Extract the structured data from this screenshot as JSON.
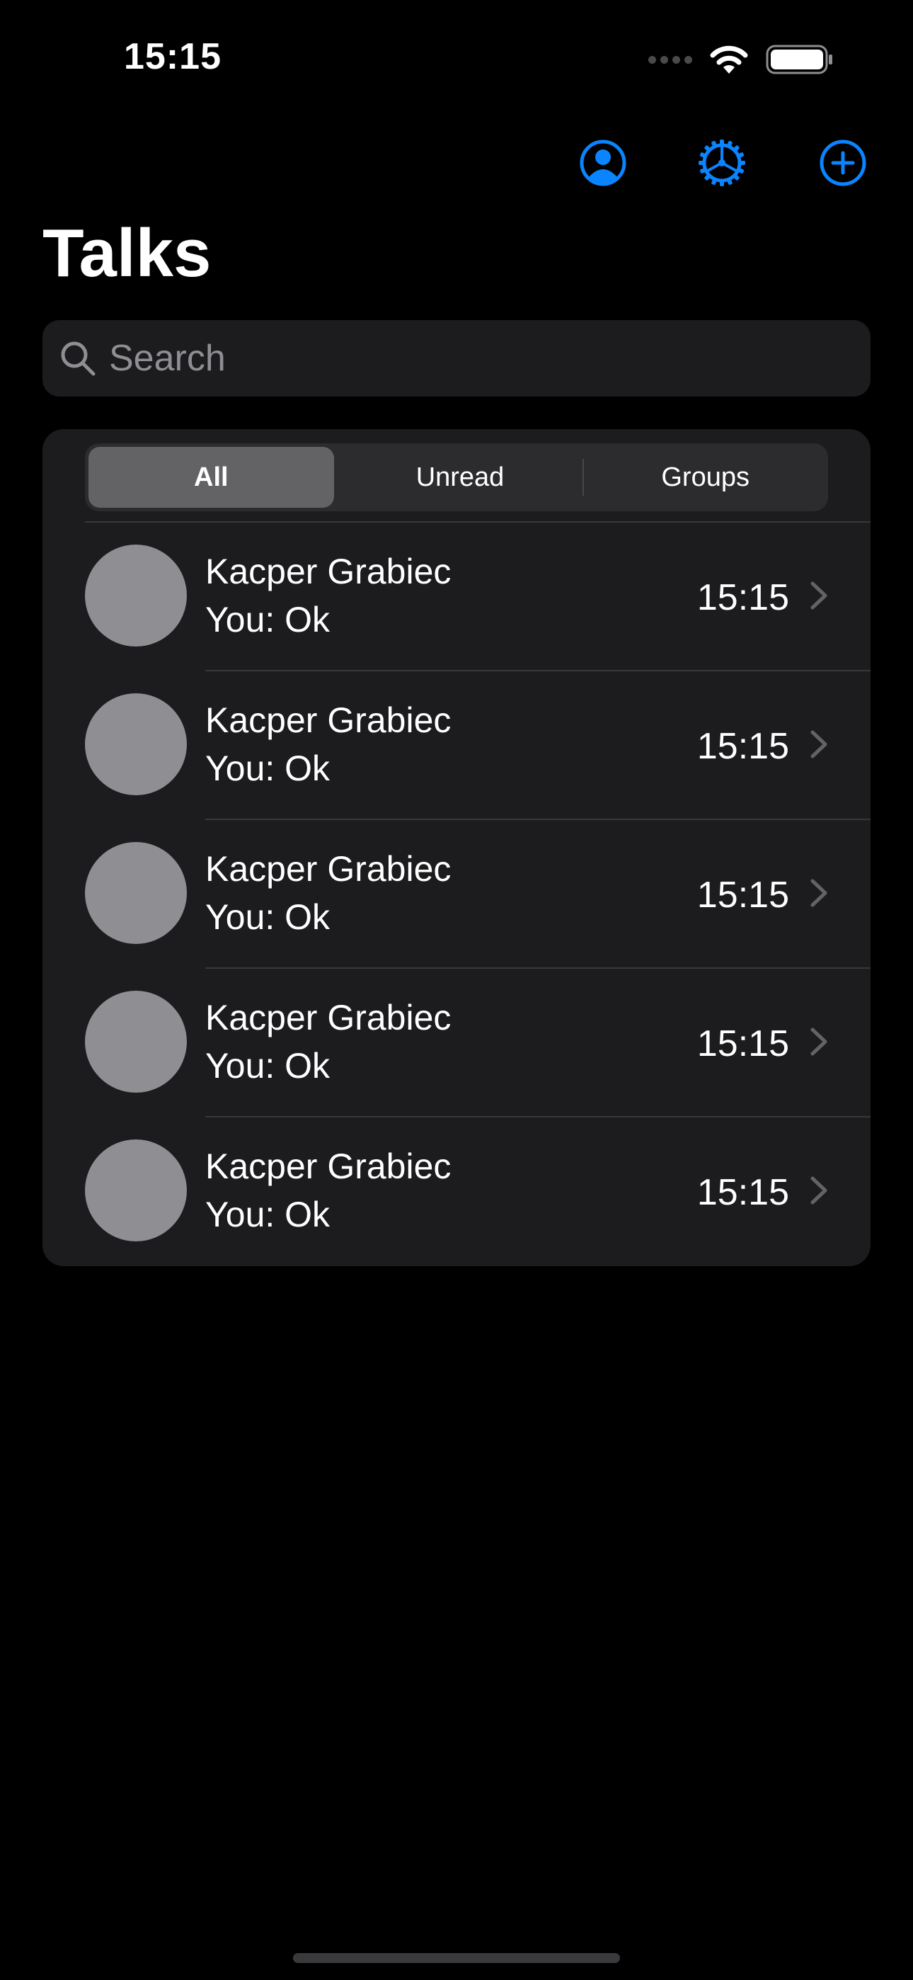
{
  "status_bar": {
    "time": "15:15"
  },
  "toolbar": {
    "icons": [
      "person-circle-icon",
      "gear-icon",
      "plus-circle-icon"
    ],
    "accent_color": "#0a84ff"
  },
  "title": "Talks",
  "search": {
    "placeholder": "Search",
    "value": ""
  },
  "tabs": {
    "items": [
      {
        "label": "All",
        "selected": true
      },
      {
        "label": "Unread",
        "selected": false
      },
      {
        "label": "Groups",
        "selected": false
      }
    ]
  },
  "conversations": [
    {
      "name": "Kacper Grabiec",
      "preview": "You: Ok",
      "time": "15:15"
    },
    {
      "name": "Kacper Grabiec",
      "preview": "You: Ok",
      "time": "15:15"
    },
    {
      "name": "Kacper Grabiec",
      "preview": "You: Ok",
      "time": "15:15"
    },
    {
      "name": "Kacper Grabiec",
      "preview": "You: Ok",
      "time": "15:15"
    },
    {
      "name": "Kacper Grabiec",
      "preview": "You: Ok",
      "time": "15:15"
    }
  ]
}
